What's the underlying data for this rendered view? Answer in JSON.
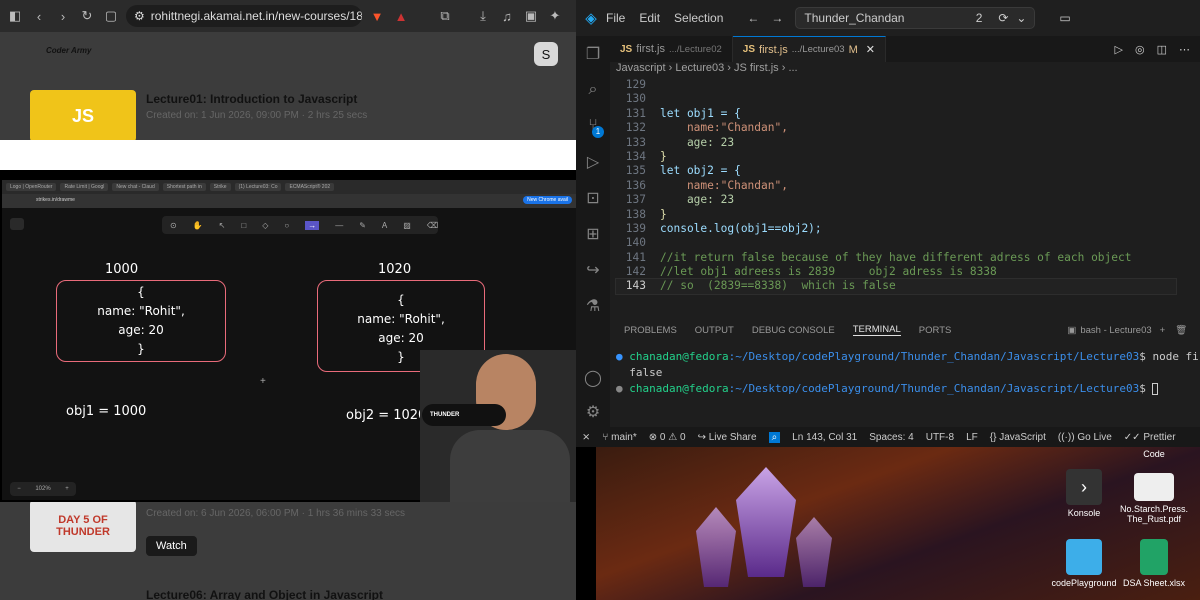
{
  "browser": {
    "url": "rohittnegi.akamai.net.in/new-courses/18/conte...",
    "profile_initial": "S",
    "logo_text": "Coder Army",
    "courses": [
      {
        "thumb_text": "JS",
        "title": "Lecture01: Introduction to Javascript",
        "meta": "Created on: 1 Jun 2026, 09:00 PM  ·  2 hrs 25 secs"
      },
      {
        "thumb_text": "DAY 5 OF THUNDER",
        "title": "",
        "meta": "Created on: 6 Jun 2026, 06:00 PM  ·  1 hrs 36 mins 33 secs",
        "button": "Watch"
      },
      {
        "title": "Lecture06: Array and Object in Javascript"
      }
    ]
  },
  "video": {
    "inner_tabs": [
      "Logo | OpenRouter",
      "Rate Limit | Googl",
      "New chat - Claud",
      "Shortest path in",
      "Strike",
      "(1) Lecture03: Co",
      "ECMAScript® 202"
    ],
    "inner_url": "strikes.in/drawme",
    "chrome_badge": "New Chrome avail",
    "zoom": "102%",
    "addr1": "1000",
    "addr2": "1020",
    "obj_open": "{",
    "obj_name": "name: \"Rohit\",",
    "obj_age": "age: 20",
    "obj_close": "}",
    "obj1_label": "obj1 = 1000",
    "obj2_label": "obj2 = 1020",
    "mic_label": "THUNDER"
  },
  "vscode": {
    "menu": [
      "File",
      "Edit",
      "Selection"
    ],
    "search": "Thunder_Chandan",
    "notif_count": "2",
    "tabs": [
      {
        "badge": "JS",
        "name": "first.js",
        "path": ".../Lecture02",
        "active": false
      },
      {
        "badge": "JS",
        "name": "first.js",
        "path": ".../Lecture03",
        "flag": "M",
        "active": true
      }
    ],
    "breadcrumb": [
      "Javascript",
      "Lecture03",
      "JS first.js",
      "..."
    ],
    "code_lines": [
      {
        "n": "129",
        "t": ""
      },
      {
        "n": "130",
        "t": ""
      },
      {
        "n": "131",
        "t": "let obj1 = {"
      },
      {
        "n": "132",
        "t": "    name:\"Chandan\","
      },
      {
        "n": "133",
        "t": "    age: 23"
      },
      {
        "n": "134",
        "t": "}"
      },
      {
        "n": "135",
        "t": "let obj2 = {"
      },
      {
        "n": "136",
        "t": "    name:\"Chandan\","
      },
      {
        "n": "137",
        "t": "    age: 23"
      },
      {
        "n": "138",
        "t": "}"
      },
      {
        "n": "139",
        "t": "console.log(obj1==obj2);"
      },
      {
        "n": "140",
        "t": ""
      },
      {
        "n": "141",
        "t": "//it return false because of they have different adress of each object"
      },
      {
        "n": "142",
        "t": "//let obj1 adreess is 2839     obj2 adress is 8338"
      },
      {
        "n": "143",
        "t": "// so  (2839==8338)  which is false"
      }
    ],
    "panel_tabs": [
      "PROBLEMS",
      "OUTPUT",
      "DEBUG CONSOLE",
      "TERMINAL",
      "PORTS"
    ],
    "terminal_name": "bash - Lecture03",
    "terminal": [
      {
        "prompt": "chanadan@fedora",
        "path": ":~/Desktop/codePlayground/Thunder_Chandan/Javascript/Lecture03",
        "cmd": "$ node first.js"
      },
      {
        "out": "false"
      },
      {
        "prompt": "chanadan@fedora",
        "path": ":~/Desktop/codePlayground/Thunder_Chandan/Javascript/Lecture03",
        "cmd": "$ "
      }
    ],
    "status": {
      "branch": "main*",
      "errors": "0",
      "warnings": "0",
      "live_share": "Live Share",
      "position": "Ln 143, Col 31",
      "spaces": "Spaces: 4",
      "encoding": "UTF-8",
      "eol": "LF",
      "language": "JavaScript",
      "golive": "Go Live",
      "prettier": "Prettier"
    },
    "source_control_badge": "1"
  },
  "desktop": {
    "icons": [
      {
        "label": "Code",
        "icon": "vscode-icon"
      },
      {
        "label": "Konsole",
        "icon": "terminal-icon"
      },
      {
        "label": "No.Starch.Press. The_Rust.pdf",
        "icon": "pdf-icon"
      },
      {
        "label": "codePlayground",
        "icon": "folder-icon"
      },
      {
        "label": "DSA Sheet.xlsx",
        "icon": "spreadsheet-icon"
      }
    ]
  }
}
